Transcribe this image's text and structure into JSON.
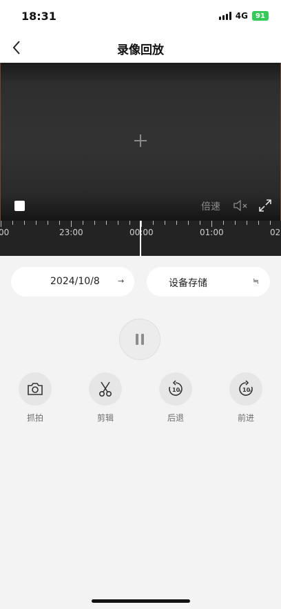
{
  "status_bar": {
    "time": "18:31",
    "network": "4G",
    "battery": "91"
  },
  "header": {
    "title": "录像回放"
  },
  "player": {
    "speed_label": "倍速"
  },
  "timeline": {
    "labels": [
      "00",
      "23:00",
      "00:00",
      "01:00",
      "02"
    ],
    "current": "00:00"
  },
  "filters": {
    "date": "2024/10/8",
    "date_icon": "→",
    "storage": "设备存储",
    "storage_icon": "≒"
  },
  "actions": [
    {
      "label": "抓拍",
      "icon": "camera-icon"
    },
    {
      "label": "剪辑",
      "icon": "scissors-icon"
    },
    {
      "label": "后退",
      "icon": "rewind-10s-icon"
    },
    {
      "label": "前进",
      "icon": "forward-10s-icon"
    }
  ],
  "colors": {
    "background": "#f3f3f3",
    "battery": "#38c95b",
    "video": "#2e2e2e"
  }
}
